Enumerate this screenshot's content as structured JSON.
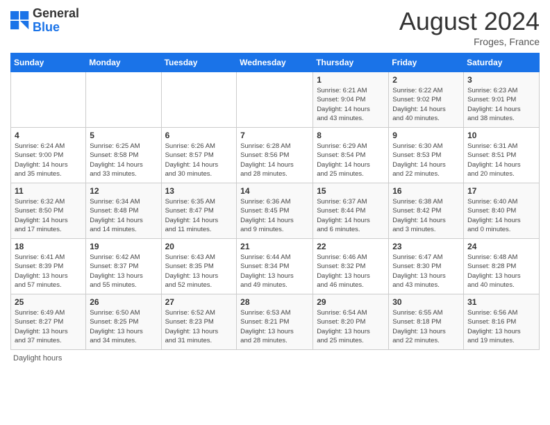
{
  "header": {
    "logo_general": "General",
    "logo_blue": "Blue",
    "month_year": "August 2024",
    "location": "Froges, France"
  },
  "footer": {
    "daylight_label": "Daylight hours"
  },
  "days_of_week": [
    "Sunday",
    "Monday",
    "Tuesday",
    "Wednesday",
    "Thursday",
    "Friday",
    "Saturday"
  ],
  "weeks": [
    [
      {
        "day": "",
        "info": ""
      },
      {
        "day": "",
        "info": ""
      },
      {
        "day": "",
        "info": ""
      },
      {
        "day": "",
        "info": ""
      },
      {
        "day": "1",
        "info": "Sunrise: 6:21 AM\nSunset: 9:04 PM\nDaylight: 14 hours\nand 43 minutes."
      },
      {
        "day": "2",
        "info": "Sunrise: 6:22 AM\nSunset: 9:02 PM\nDaylight: 14 hours\nand 40 minutes."
      },
      {
        "day": "3",
        "info": "Sunrise: 6:23 AM\nSunset: 9:01 PM\nDaylight: 14 hours\nand 38 minutes."
      }
    ],
    [
      {
        "day": "4",
        "info": "Sunrise: 6:24 AM\nSunset: 9:00 PM\nDaylight: 14 hours\nand 35 minutes."
      },
      {
        "day": "5",
        "info": "Sunrise: 6:25 AM\nSunset: 8:58 PM\nDaylight: 14 hours\nand 33 minutes."
      },
      {
        "day": "6",
        "info": "Sunrise: 6:26 AM\nSunset: 8:57 PM\nDaylight: 14 hours\nand 30 minutes."
      },
      {
        "day": "7",
        "info": "Sunrise: 6:28 AM\nSunset: 8:56 PM\nDaylight: 14 hours\nand 28 minutes."
      },
      {
        "day": "8",
        "info": "Sunrise: 6:29 AM\nSunset: 8:54 PM\nDaylight: 14 hours\nand 25 minutes."
      },
      {
        "day": "9",
        "info": "Sunrise: 6:30 AM\nSunset: 8:53 PM\nDaylight: 14 hours\nand 22 minutes."
      },
      {
        "day": "10",
        "info": "Sunrise: 6:31 AM\nSunset: 8:51 PM\nDaylight: 14 hours\nand 20 minutes."
      }
    ],
    [
      {
        "day": "11",
        "info": "Sunrise: 6:32 AM\nSunset: 8:50 PM\nDaylight: 14 hours\nand 17 minutes."
      },
      {
        "day": "12",
        "info": "Sunrise: 6:34 AM\nSunset: 8:48 PM\nDaylight: 14 hours\nand 14 minutes."
      },
      {
        "day": "13",
        "info": "Sunrise: 6:35 AM\nSunset: 8:47 PM\nDaylight: 14 hours\nand 11 minutes."
      },
      {
        "day": "14",
        "info": "Sunrise: 6:36 AM\nSunset: 8:45 PM\nDaylight: 14 hours\nand 9 minutes."
      },
      {
        "day": "15",
        "info": "Sunrise: 6:37 AM\nSunset: 8:44 PM\nDaylight: 14 hours\nand 6 minutes."
      },
      {
        "day": "16",
        "info": "Sunrise: 6:38 AM\nSunset: 8:42 PM\nDaylight: 14 hours\nand 3 minutes."
      },
      {
        "day": "17",
        "info": "Sunrise: 6:40 AM\nSunset: 8:40 PM\nDaylight: 14 hours\nand 0 minutes."
      }
    ],
    [
      {
        "day": "18",
        "info": "Sunrise: 6:41 AM\nSunset: 8:39 PM\nDaylight: 13 hours\nand 57 minutes."
      },
      {
        "day": "19",
        "info": "Sunrise: 6:42 AM\nSunset: 8:37 PM\nDaylight: 13 hours\nand 55 minutes."
      },
      {
        "day": "20",
        "info": "Sunrise: 6:43 AM\nSunset: 8:35 PM\nDaylight: 13 hours\nand 52 minutes."
      },
      {
        "day": "21",
        "info": "Sunrise: 6:44 AM\nSunset: 8:34 PM\nDaylight: 13 hours\nand 49 minutes."
      },
      {
        "day": "22",
        "info": "Sunrise: 6:46 AM\nSunset: 8:32 PM\nDaylight: 13 hours\nand 46 minutes."
      },
      {
        "day": "23",
        "info": "Sunrise: 6:47 AM\nSunset: 8:30 PM\nDaylight: 13 hours\nand 43 minutes."
      },
      {
        "day": "24",
        "info": "Sunrise: 6:48 AM\nSunset: 8:28 PM\nDaylight: 13 hours\nand 40 minutes."
      }
    ],
    [
      {
        "day": "25",
        "info": "Sunrise: 6:49 AM\nSunset: 8:27 PM\nDaylight: 13 hours\nand 37 minutes."
      },
      {
        "day": "26",
        "info": "Sunrise: 6:50 AM\nSunset: 8:25 PM\nDaylight: 13 hours\nand 34 minutes."
      },
      {
        "day": "27",
        "info": "Sunrise: 6:52 AM\nSunset: 8:23 PM\nDaylight: 13 hours\nand 31 minutes."
      },
      {
        "day": "28",
        "info": "Sunrise: 6:53 AM\nSunset: 8:21 PM\nDaylight: 13 hours\nand 28 minutes."
      },
      {
        "day": "29",
        "info": "Sunrise: 6:54 AM\nSunset: 8:20 PM\nDaylight: 13 hours\nand 25 minutes."
      },
      {
        "day": "30",
        "info": "Sunrise: 6:55 AM\nSunset: 8:18 PM\nDaylight: 13 hours\nand 22 minutes."
      },
      {
        "day": "31",
        "info": "Sunrise: 6:56 AM\nSunset: 8:16 PM\nDaylight: 13 hours\nand 19 minutes."
      }
    ]
  ]
}
